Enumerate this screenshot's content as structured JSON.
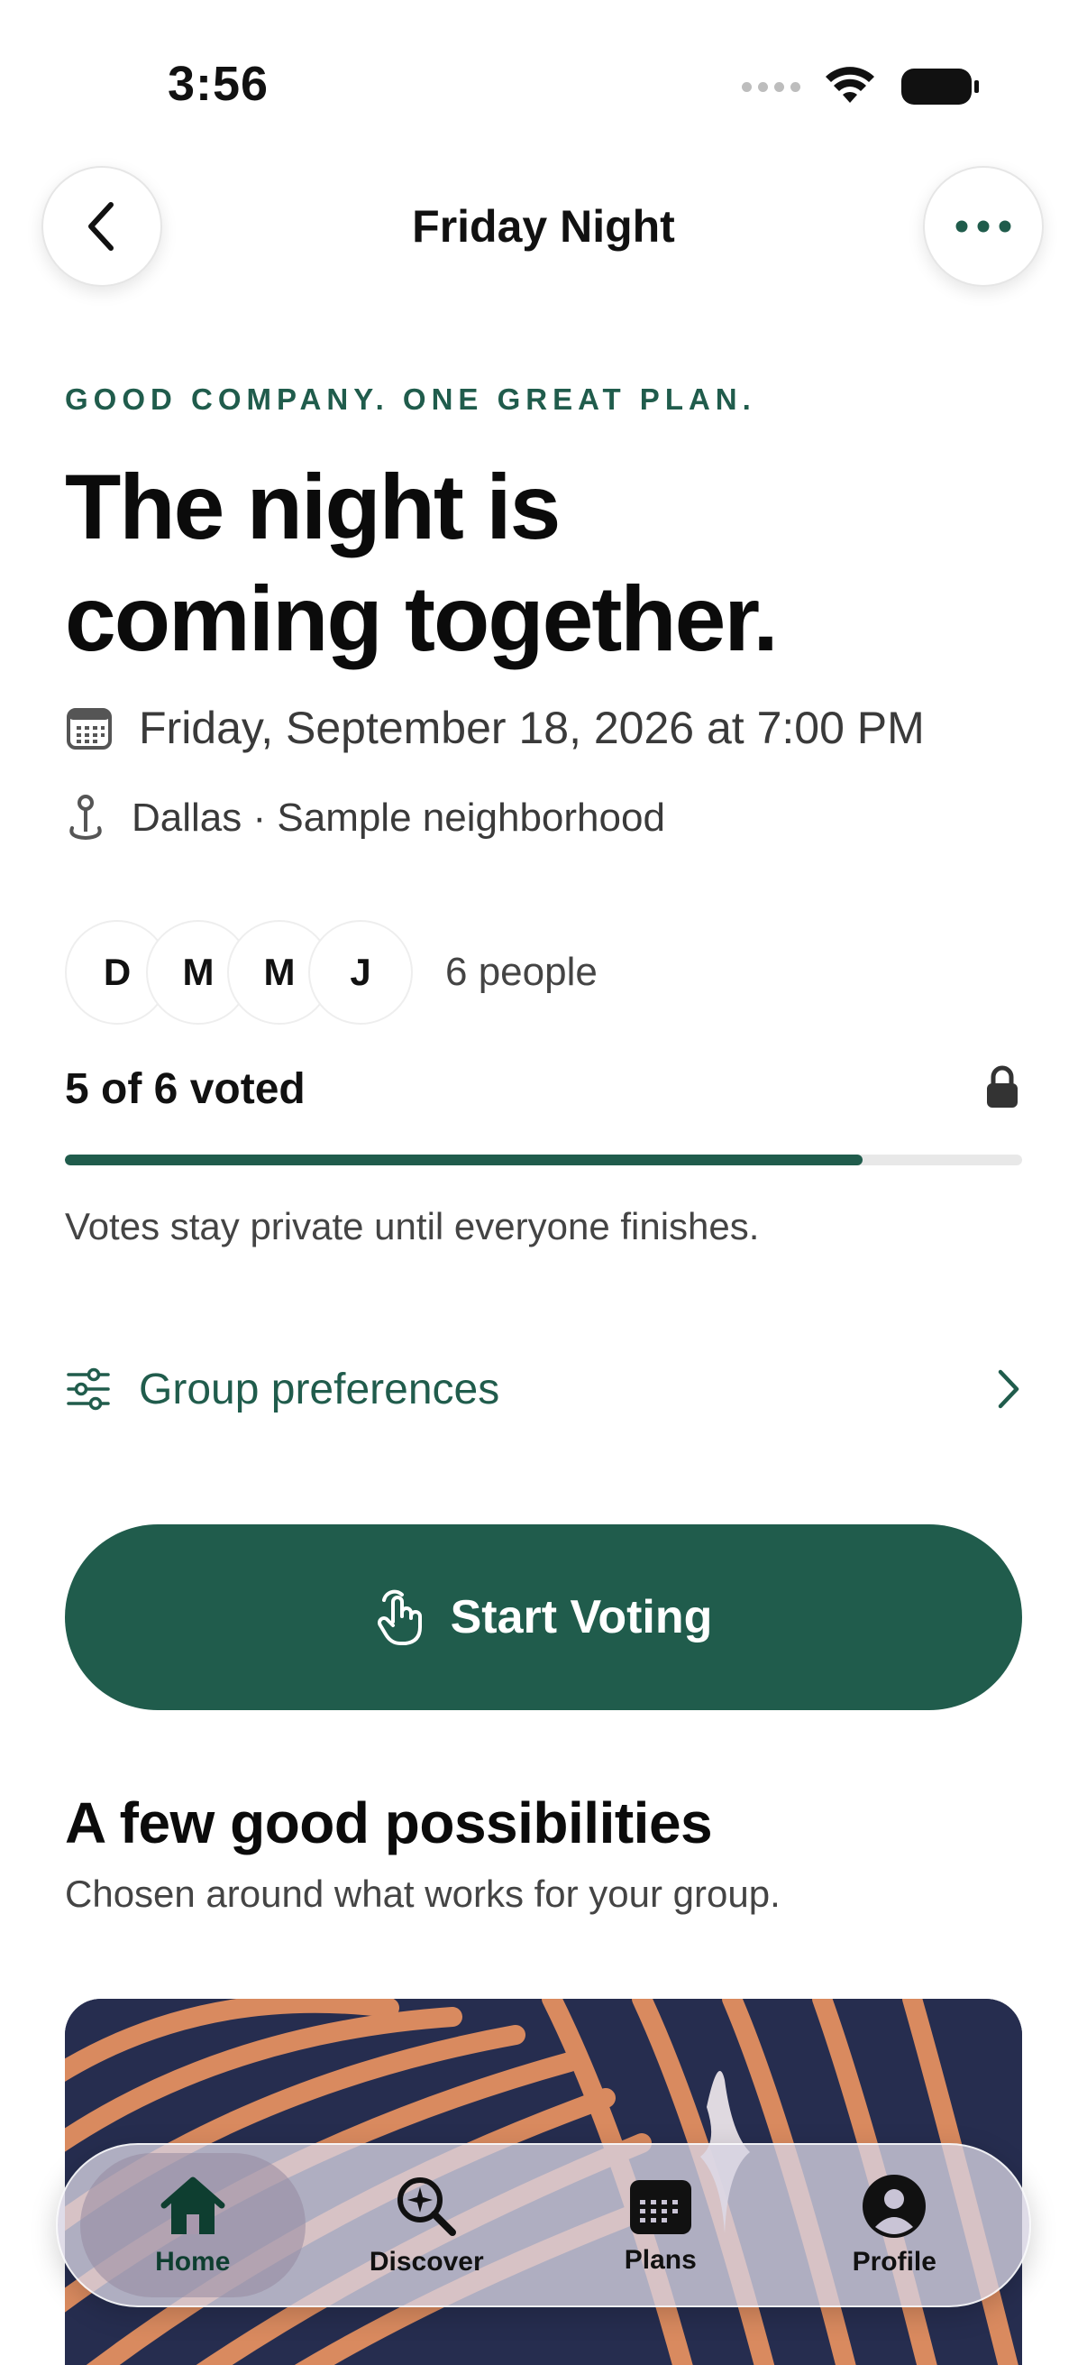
{
  "status_bar": {
    "time": "3:56"
  },
  "nav": {
    "title": "Friday Night",
    "back_icon": "chevron-left-icon",
    "more_icon": "ellipsis-icon"
  },
  "hero": {
    "eyebrow": "GOOD COMPANY. ONE GREAT PLAN.",
    "headline_line1": "The night is",
    "headline_line2": "coming together."
  },
  "details": {
    "date": "Friday, September 18, 2026 at 7:00 PM",
    "location": "Dallas · Sample neighborhood"
  },
  "group": {
    "avatars": [
      "D",
      "M",
      "M",
      "J"
    ],
    "people_count": "6 people"
  },
  "voting": {
    "status": "5 of 6 voted",
    "progress": 0.833,
    "note": "Votes stay private until everyone finishes."
  },
  "preferences": {
    "label": "Group preferences"
  },
  "cta": {
    "label": "Start Voting"
  },
  "possibilities": {
    "title": "A few good possibilities",
    "subtitle": "Chosen around what works for your group."
  },
  "colors": {
    "accent": "#205c4c",
    "card_bg": "#262d4f",
    "card_stripe": "#d98a5f"
  },
  "tabs": [
    {
      "label": "Home",
      "icon": "house-icon",
      "active": true
    },
    {
      "label": "Discover",
      "icon": "magnify-sparkle-icon",
      "active": false
    },
    {
      "label": "Plans",
      "icon": "calendar-icon",
      "active": false
    },
    {
      "label": "Profile",
      "icon": "person-circle-icon",
      "active": false
    }
  ]
}
